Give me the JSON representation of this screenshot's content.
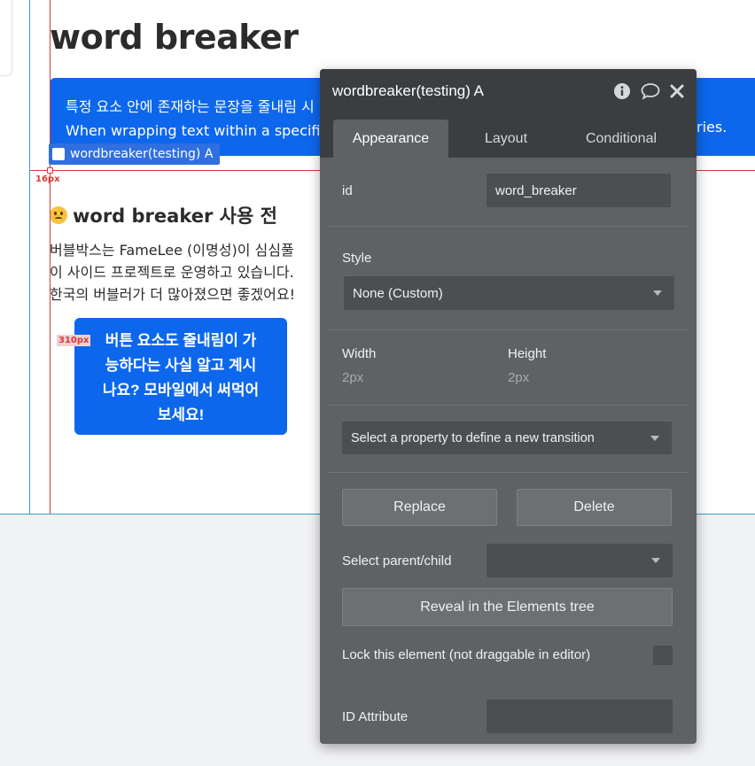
{
  "page": {
    "title": "word breaker",
    "info_lines": [
      "특정 요소 안에 존재하는 문장을 줄내림 시",
      "When wrapping text within a specifi"
    ],
    "info_tail": "ries.",
    "selected_label": "wordbreaker(testing) A",
    "guide_top_label": "16px",
    "guide_left_label": "310px",
    "section_heading": "word breaker 사용 전",
    "body_lines": [
      "버블박스는 FameLee (이명성)이 심심풀",
      "이 사이드 프로젝트로 운영하고 있습니다.",
      "한국의 버블러가 더 많아졌으면 좋겠어요!"
    ],
    "cta_lines": [
      "버튼 요소도 줄내림이 가",
      "능하다는 사실 알고 계시",
      "나요? 모바일에서 써먹어",
      "보세요!"
    ]
  },
  "panel": {
    "title": "wordbreaker(testing) A",
    "icons": [
      "info-icon",
      "comment-icon",
      "close-icon"
    ],
    "tabs": [
      {
        "label": "Appearance",
        "active": true
      },
      {
        "label": "Layout",
        "active": false
      },
      {
        "label": "Conditional",
        "active": false
      }
    ],
    "id_label": "id",
    "id_value": "word_breaker",
    "style_label": "Style",
    "style_value": "None (Custom)",
    "width_label": "Width",
    "width_value": "2px",
    "height_label": "Height",
    "height_value": "2px",
    "transition_placeholder": "Select a property to define a new transition",
    "replace_label": "Replace",
    "delete_label": "Delete",
    "parent_child_label": "Select parent/child",
    "parent_child_value": "",
    "reveal_label": "Reveal in the Elements tree",
    "lock_label": "Lock this element (not draggable in editor)",
    "id_attribute_label": "ID Attribute",
    "id_attribute_value": ""
  }
}
